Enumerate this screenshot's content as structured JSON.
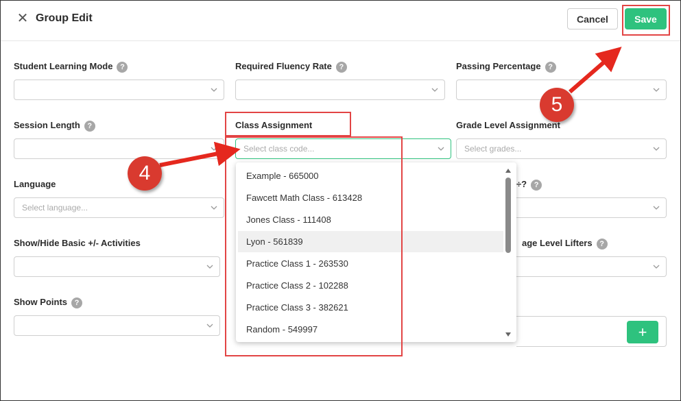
{
  "header": {
    "title": "Group Edit",
    "cancel_label": "Cancel",
    "save_label": "Save"
  },
  "fields": {
    "student_learning_mode": {
      "label": "Student Learning Mode",
      "value": ""
    },
    "required_fluency_rate": {
      "label": "Required Fluency Rate",
      "value": ""
    },
    "passing_percentage": {
      "label": "Passing Percentage",
      "value": ""
    },
    "session_length": {
      "label": "Session Length",
      "value": ""
    },
    "class_assignment": {
      "label": "Class Assignment",
      "placeholder": "Select class code..."
    },
    "grade_level_assignment": {
      "label": "Grade Level Assignment",
      "placeholder": "Select grades..."
    },
    "language": {
      "label": "Language",
      "placeholder": "Select language..."
    },
    "partial_right_label": "÷?",
    "show_hide_basic": {
      "label": "Show/Hide Basic +/- Activities",
      "value": ""
    },
    "partial_lifters_label": "age Level Lifters",
    "show_points": {
      "label": "Show Points",
      "value": ""
    }
  },
  "help_glyph": "?",
  "dropdown": {
    "options": [
      "Example - 665000",
      "Fawcett Math Class - 613428",
      "Jones Class - 111408",
      "Lyon - 561839",
      "Practice Class 1 - 263530",
      "Practice Class 2 - 102288",
      "Practice Class 3 - 382621",
      "Random - 549997"
    ],
    "highlighted_index": 3
  },
  "annotations": {
    "step4": "4",
    "step5": "5"
  },
  "plus_label": "+",
  "colors": {
    "accent_green": "#2ec27e",
    "annotation_red": "#e24444",
    "badge_red": "#d93a2f"
  }
}
